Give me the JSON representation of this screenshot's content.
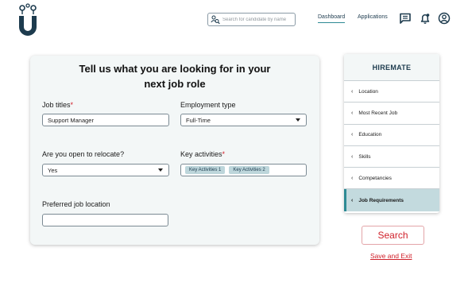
{
  "header": {
    "search_placeholder": "Search for candidate by name",
    "nav": {
      "dashboard": "Dashboard",
      "applications": "Applications"
    },
    "icons": [
      "message-icon",
      "bell-icon",
      "profile-icon"
    ]
  },
  "form": {
    "title_line1": "Tell us what you are looking for in your",
    "title_line2": "next job role",
    "job_titles": {
      "label": "Job titles",
      "required": "*",
      "value": "Support Manager"
    },
    "employment_type": {
      "label": "Employment type",
      "value": "Full-Time"
    },
    "relocate": {
      "label": "Are you open to relocate?",
      "value": "Yes"
    },
    "key_activities": {
      "label": "Key activities",
      "required": "*",
      "chips": [
        "Key Activities 1",
        "Key Activities 2"
      ]
    },
    "preferred_location": {
      "label": "Preferred job location",
      "value": ""
    }
  },
  "sidebar": {
    "title": "HIREMATE",
    "items": [
      {
        "label": "Location"
      },
      {
        "label": "Most Recent Job"
      },
      {
        "label": "Education"
      },
      {
        "label": "Skills"
      },
      {
        "label": "Competancies"
      },
      {
        "label": "Job Requirements"
      }
    ],
    "active_index": 5
  },
  "actions": {
    "search_label": "Search",
    "save_label": "Save and Exit"
  },
  "colors": {
    "accent": "#2d8a94",
    "danger": "#d0202a",
    "navy": "#1d3b4e",
    "active_bg": "#c3dade",
    "card_bg": "#f3f7f7"
  }
}
